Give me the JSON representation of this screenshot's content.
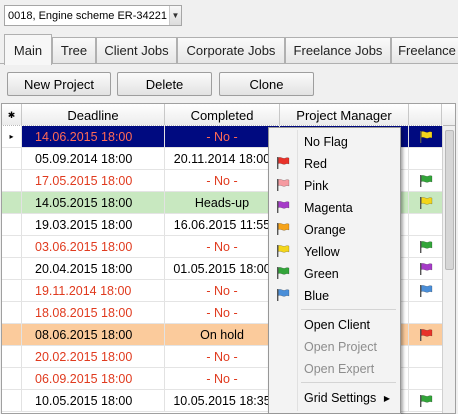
{
  "job_selector": {
    "value": "0018, Engine scheme ER-34221"
  },
  "tabs": [
    {
      "label": "Main"
    },
    {
      "label": "Tree"
    },
    {
      "label": "Client Jobs"
    },
    {
      "label": "Corporate Jobs"
    },
    {
      "label": "Freelance Jobs"
    },
    {
      "label": "Freelance"
    }
  ],
  "toolbar": {
    "new_project": "New Project",
    "delete": "Delete",
    "clone": "Clone"
  },
  "grid": {
    "columns": {
      "indicator": "✱",
      "deadline": "Deadline",
      "completed": "Completed",
      "manager": "Project Manager"
    },
    "rows": [
      {
        "indicator": "▸",
        "deadline": "14.06.2015 18:00",
        "deadline_overdue": true,
        "completed": "- No -",
        "completed_missing": true,
        "flag": "yellow",
        "selected": true,
        "highlight": ""
      },
      {
        "indicator": "",
        "deadline": "05.09.2014 18:00",
        "deadline_overdue": false,
        "completed": "20.11.2014 18:00",
        "completed_missing": false,
        "flag": "",
        "selected": false,
        "highlight": ""
      },
      {
        "indicator": "",
        "deadline": "17.05.2015 18:00",
        "deadline_overdue": true,
        "completed": "- No -",
        "completed_missing": true,
        "flag": "green",
        "selected": false,
        "highlight": ""
      },
      {
        "indicator": "",
        "deadline": "14.05.2015 18:00",
        "deadline_overdue": false,
        "completed": "Heads-up",
        "completed_missing": false,
        "flag": "yellow",
        "selected": false,
        "highlight": "green"
      },
      {
        "indicator": "",
        "deadline": "19.03.2015 18:00",
        "deadline_overdue": false,
        "completed": "16.06.2015 11:55",
        "completed_missing": false,
        "flag": "",
        "selected": false,
        "highlight": ""
      },
      {
        "indicator": "",
        "deadline": "03.06.2015 18:00",
        "deadline_overdue": true,
        "completed": "- No -",
        "completed_missing": true,
        "flag": "green",
        "selected": false,
        "highlight": ""
      },
      {
        "indicator": "",
        "deadline": "20.04.2015 18:00",
        "deadline_overdue": false,
        "completed": "01.05.2015 18:00",
        "completed_missing": false,
        "flag": "magenta",
        "selected": false,
        "highlight": ""
      },
      {
        "indicator": "",
        "deadline": "19.11.2014 18:00",
        "deadline_overdue": true,
        "completed": "- No -",
        "completed_missing": true,
        "flag": "blue",
        "selected": false,
        "highlight": ""
      },
      {
        "indicator": "",
        "deadline": "18.08.2015 18:00",
        "deadline_overdue": true,
        "completed": "- No -",
        "completed_missing": true,
        "flag": "",
        "selected": false,
        "highlight": ""
      },
      {
        "indicator": "",
        "deadline": "08.06.2015 18:00",
        "deadline_overdue": false,
        "completed": "On hold",
        "completed_missing": false,
        "flag": "red",
        "selected": false,
        "highlight": "orange"
      },
      {
        "indicator": "",
        "deadline": "20.02.2015 18:00",
        "deadline_overdue": true,
        "completed": "- No -",
        "completed_missing": true,
        "flag": "",
        "selected": false,
        "highlight": ""
      },
      {
        "indicator": "",
        "deadline": "06.09.2015 18:00",
        "deadline_overdue": true,
        "completed": "- No -",
        "completed_missing": true,
        "flag": "",
        "selected": false,
        "highlight": ""
      },
      {
        "indicator": "",
        "deadline": "10.05.2015 18:00",
        "deadline_overdue": false,
        "completed": "10.05.2015 18:35",
        "completed_missing": false,
        "flag": "green",
        "selected": false,
        "highlight": ""
      }
    ]
  },
  "context_menu": {
    "items": [
      {
        "label": "No Flag",
        "flag": "",
        "disabled": false,
        "submenu": false,
        "separator_after": false
      },
      {
        "label": "Red",
        "flag": "red",
        "disabled": false,
        "submenu": false,
        "separator_after": false
      },
      {
        "label": "Pink",
        "flag": "pink",
        "disabled": false,
        "submenu": false,
        "separator_after": false
      },
      {
        "label": "Magenta",
        "flag": "magenta",
        "disabled": false,
        "submenu": false,
        "separator_after": false
      },
      {
        "label": "Orange",
        "flag": "orange",
        "disabled": false,
        "submenu": false,
        "separator_after": false
      },
      {
        "label": "Yellow",
        "flag": "yellow",
        "disabled": false,
        "submenu": false,
        "separator_after": false
      },
      {
        "label": "Green",
        "flag": "green",
        "disabled": false,
        "submenu": false,
        "separator_after": false
      },
      {
        "label": "Blue",
        "flag": "blue",
        "disabled": false,
        "submenu": false,
        "separator_after": true
      },
      {
        "label": "Open Client",
        "flag": "",
        "disabled": false,
        "submenu": false,
        "separator_after": false
      },
      {
        "label": "Open Project",
        "flag": "",
        "disabled": true,
        "submenu": false,
        "separator_after": false
      },
      {
        "label": "Open Expert",
        "flag": "",
        "disabled": true,
        "submenu": false,
        "separator_after": true
      },
      {
        "label": "Grid Settings",
        "flag": "",
        "disabled": false,
        "submenu": true,
        "separator_after": false
      }
    ]
  },
  "flag_colors": {
    "red": "#e8322a",
    "pink": "#f59aa0",
    "magenta": "#a63cc8",
    "orange": "#f5a31a",
    "yellow": "#f3d51b",
    "green": "#33a53a",
    "blue": "#4a8ed8"
  },
  "highlight_colors": {
    "green": "#c8e8c0",
    "orange": "#fbcb9c"
  }
}
